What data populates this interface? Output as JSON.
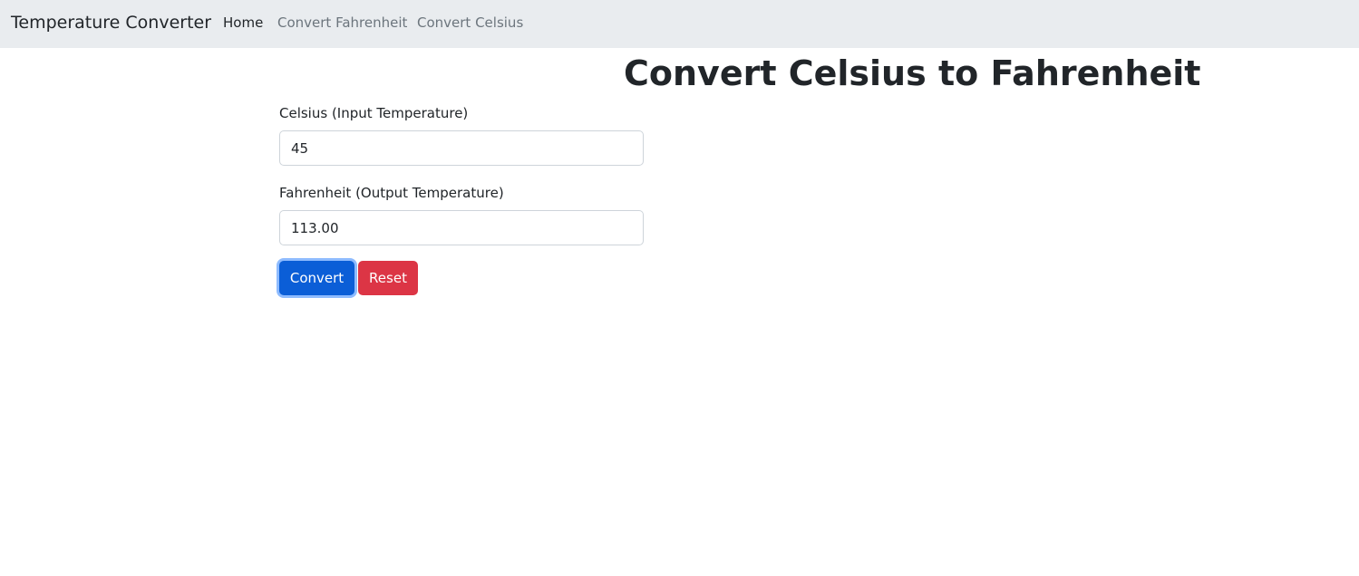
{
  "navbar": {
    "brand": "Temperature Converter",
    "links": [
      {
        "label": "Home",
        "active": true
      },
      {
        "label": "Convert Fahrenheit",
        "active": false
      },
      {
        "label": "Convert Celsius",
        "active": false
      }
    ]
  },
  "main": {
    "title": "Convert Celsius to Fahrenheit",
    "input": {
      "label": "Celsius (Input Temperature)",
      "value": "45"
    },
    "output": {
      "label": "Fahrenheit (Output Temperature)",
      "value": "113.00"
    },
    "buttons": {
      "convert_label": "Convert",
      "reset_label": "Reset"
    }
  },
  "colors": {
    "navbar_bg": "#e9ecef",
    "primary": "#0b5ed7",
    "danger": "#dc3545",
    "text": "#212529",
    "muted_link": "#6c757d"
  }
}
